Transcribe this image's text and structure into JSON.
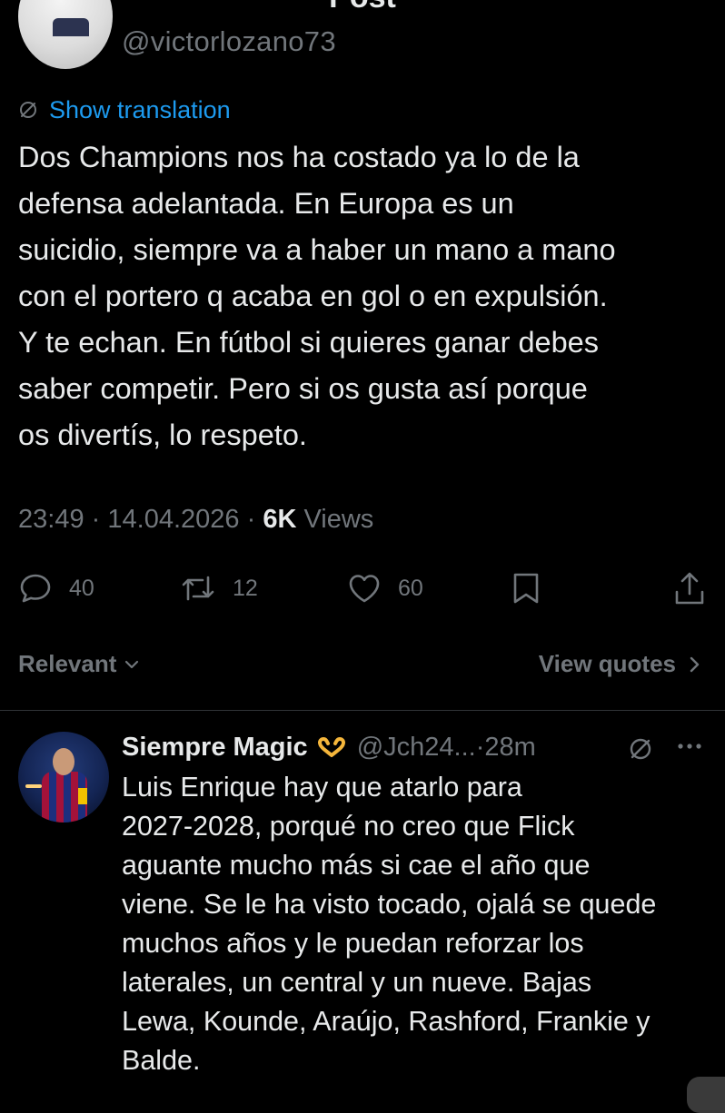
{
  "header": {
    "title": "Post",
    "back_icon": "arrow-left-icon"
  },
  "author": {
    "handle": "@victorlozano73"
  },
  "translation": {
    "icon": "translate-icon",
    "label": "Show translation"
  },
  "tweet": {
    "lines": [
      "Dos Champions nos ha costado ya lo de la",
      "defensa adelantada. En Europa es un",
      "suicidio, siempre va a haber un mano a mano",
      "con el portero q acaba en gol o en expulsión.",
      "Y te echan. En fútbol si quieres ganar debes",
      "saber competir. Pero si os gusta así porque",
      "os divertís, lo respeto."
    ],
    "time": "23:49",
    "separator": "·",
    "date": "14.04.2026",
    "views_count": "6K",
    "views_label": "Views"
  },
  "actions": {
    "replies": "40",
    "reposts": "12",
    "likes": "60"
  },
  "sort": {
    "relevant": "Relevant",
    "view_quotes": "View quotes"
  },
  "reply": {
    "name": "Siempre Magic",
    "emoji": "heart-hands-icon",
    "handle": "@Jch24...",
    "separator": "·",
    "time": "28m",
    "lines": [
      "Luis Enrique hay que atarlo para",
      "2027-2028, porqué no creo que Flick",
      "aguante mucho más si cae el año que",
      "viene. Se le ha visto tocado, ojalá se quede",
      "muchos años y le puedan reforzar los",
      "laterales, un central y un nueve. Bajas",
      "Lewa, Kounde, Araújo, Rashford, Frankie y",
      "Balde."
    ]
  },
  "colors": {
    "background": "#000000",
    "text": "#e7e9ea",
    "secondary": "#71767b",
    "link": "#1d9bf0",
    "divider": "#2f3336"
  }
}
